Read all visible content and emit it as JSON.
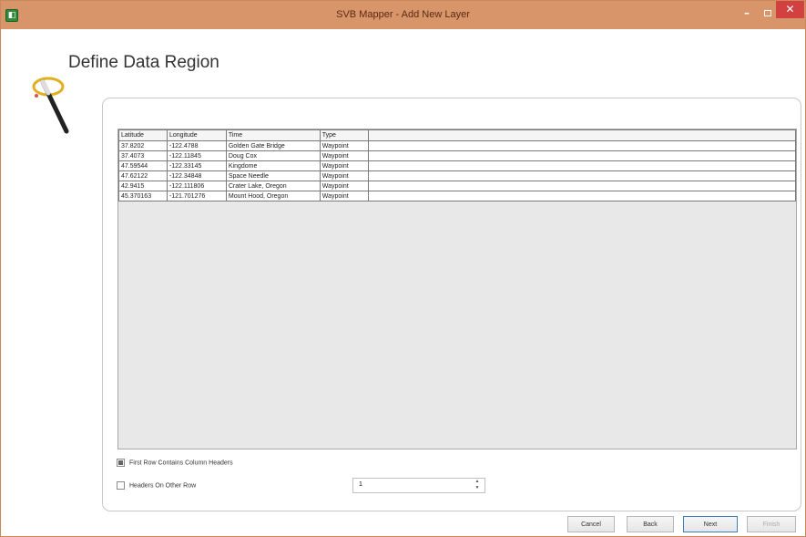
{
  "window": {
    "title": "SVB Mapper - Add New Layer",
    "icon_label": "◧",
    "min_label": "–",
    "close_label": "✕"
  },
  "page": {
    "heading": "Define Data Region"
  },
  "table": {
    "columns": [
      "Latitude",
      "Longitude",
      "Time",
      "Type"
    ],
    "rows": [
      [
        "37.8202",
        "-122.4788",
        "Golden Gate Bridge",
        "Waypoint"
      ],
      [
        "37.4073",
        "-122.11845",
        "Doug Cox",
        "Waypoint"
      ],
      [
        "47.59544",
        "-122.33145",
        "Kingdome",
        "Waypoint"
      ],
      [
        "47.62122",
        "-122.34848",
        "Space Needle",
        "Waypoint"
      ],
      [
        "42.9415",
        "-122.111806",
        "Crater Lake, Oregon",
        "Waypoint"
      ],
      [
        "45.370163",
        "-121.701276",
        "Mount Hood, Oregon",
        "Waypoint"
      ]
    ]
  },
  "options": {
    "first_row_headers": {
      "label": "First Row Contains Column Headers",
      "checked": true
    },
    "headers_other_row": {
      "label": "Headers On Other Row",
      "checked": false
    },
    "row_value": "1",
    "up_glyph": "▲",
    "down_glyph": "▼"
  },
  "buttons": {
    "cancel": "Cancel",
    "back": "Back",
    "next": "Next",
    "finish": "Finish"
  }
}
